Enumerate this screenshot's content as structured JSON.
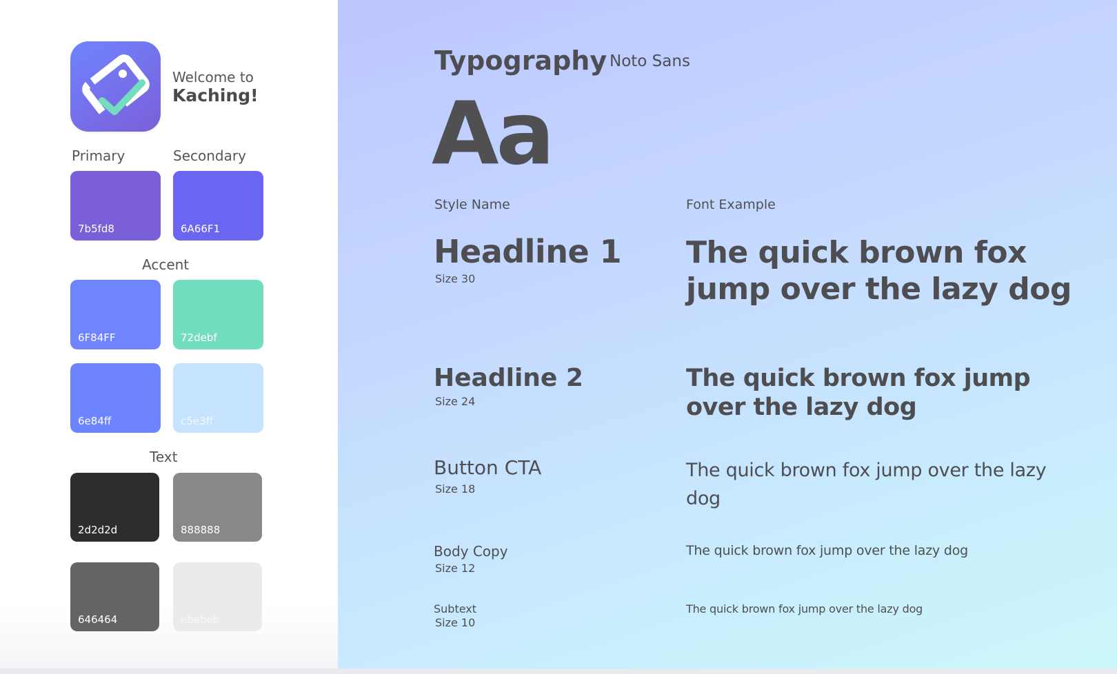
{
  "brand": {
    "welcome_line1": "Welcome to",
    "welcome_line2": "Kaching!"
  },
  "palette": {
    "primary_label": "Primary",
    "secondary_label": "Secondary",
    "accent_label": "Accent",
    "text_label": "Text",
    "primary": {
      "code": "7b5fd8",
      "color": "#7b5fd8"
    },
    "secondary": {
      "code": "6A66F1",
      "color": "#6A66F1"
    },
    "accent": [
      {
        "code": "6F84FF",
        "color": "#6F84FF"
      },
      {
        "code": "72debf",
        "color": "#72debf"
      },
      {
        "code": "6e84ff",
        "color": "#6e84ff"
      },
      {
        "code": "c5e3ff",
        "color": "#c5e3ff"
      }
    ],
    "text": [
      {
        "code": "2d2d2d",
        "color": "#2d2d2d"
      },
      {
        "code": "888888",
        "color": "#888888"
      },
      {
        "code": "646464",
        "color": "#646464"
      },
      {
        "code": "ebebeb",
        "color": "#ebebeb"
      }
    ]
  },
  "typography": {
    "title": "Typography",
    "font_name": "Noto Sans",
    "sample_glyphs": "Aa",
    "col_style": "Style Name",
    "col_example": "Font Example",
    "styles": [
      {
        "name": "Headline 1",
        "size": "Size 30",
        "example": "The quick brown fox jump over the lazy dog"
      },
      {
        "name": "Headline 2",
        "size": "Size 24",
        "example": "The quick brown fox jump over the lazy dog"
      },
      {
        "name": "Button CTA",
        "size": "Size 18",
        "example": "The quick brown fox jump over the lazy dog"
      },
      {
        "name": "Body Copy",
        "size": "Size 12",
        "example": "The quick brown fox jump over the lazy dog"
      },
      {
        "name": "Subtext",
        "size": "Size 10",
        "example": "The quick brown fox jump over the lazy dog"
      }
    ]
  }
}
